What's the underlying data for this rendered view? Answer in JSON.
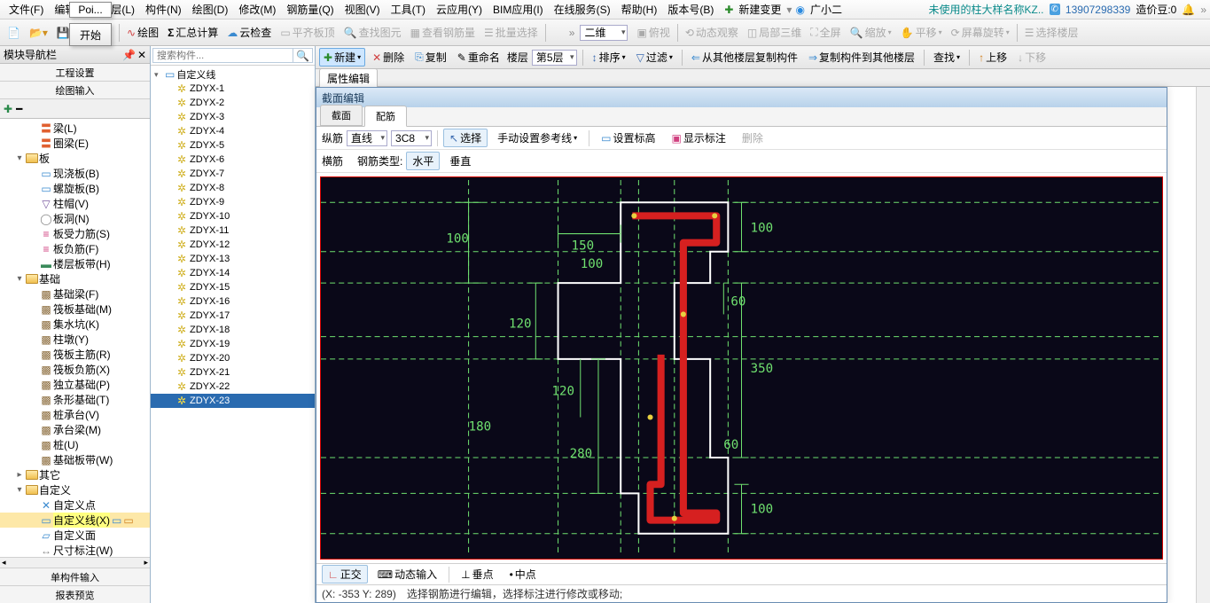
{
  "menu": {
    "items": [
      "文件(F)",
      "编辑(E)",
      "楼层(L)",
      "构件(N)",
      "绘图(D)",
      "修改(M)",
      "钢筋量(Q)",
      "视图(V)",
      "工具(T)",
      "云应用(Y)",
      "BIM应用(I)",
      "在线服务(S)",
      "帮助(H)",
      "版本号(B)"
    ],
    "new_change": "新建变更",
    "user": "广小二",
    "warn": "未使用的柱大样名称KZ..",
    "phone": "13907298339",
    "coin": "造价豆:0"
  },
  "popup": {
    "poi": "Poi...",
    "start": "开始"
  },
  "tb1": {
    "draw": "绘图",
    "sum": "汇总计算",
    "cloud": "云检查",
    "flat": "平齐板顶",
    "find": "查找图元",
    "steel": "查看钢筋量",
    "batch": "批量选择",
    "v2d": "二维",
    "bird": "俯视",
    "dyn": "动态观察",
    "loc3d": "局部三维",
    "full": "全屏",
    "zoom": "缩放",
    "pan": "平移",
    "rot": "屏幕旋转",
    "floor": "选择楼层"
  },
  "left": {
    "title": "模块导航栏",
    "sub1": "工程设置",
    "sub2": "绘图输入",
    "btm1": "单构件输入",
    "btm2": "报表预览",
    "tree": [
      {
        "d": 2,
        "ic": "beam",
        "txt": "梁(L)"
      },
      {
        "d": 2,
        "ic": "beam",
        "txt": "圈梁(E)"
      },
      {
        "d": 1,
        "ic": "fold",
        "txt": "板",
        "ex": "▾"
      },
      {
        "d": 2,
        "ic": "slab",
        "txt": "现浇板(B)"
      },
      {
        "d": 2,
        "ic": "slab",
        "txt": "螺旋板(B)"
      },
      {
        "d": 2,
        "ic": "cap",
        "txt": "柱帽(V)"
      },
      {
        "d": 2,
        "ic": "hole",
        "txt": "板洞(N)"
      },
      {
        "d": 2,
        "ic": "bar",
        "txt": "板受力筋(S)"
      },
      {
        "d": 2,
        "ic": "bar",
        "txt": "板负筋(F)"
      },
      {
        "d": 2,
        "ic": "strip",
        "txt": "楼层板带(H)"
      },
      {
        "d": 1,
        "ic": "fold",
        "txt": "基础",
        "ex": "▾"
      },
      {
        "d": 2,
        "ic": "fnd",
        "txt": "基础梁(F)"
      },
      {
        "d": 2,
        "ic": "fnd",
        "txt": "筏板基础(M)"
      },
      {
        "d": 2,
        "ic": "fnd",
        "txt": "集水坑(K)"
      },
      {
        "d": 2,
        "ic": "fnd",
        "txt": "柱墩(Y)"
      },
      {
        "d": 2,
        "ic": "fnd",
        "txt": "筏板主筋(R)"
      },
      {
        "d": 2,
        "ic": "fnd",
        "txt": "筏板负筋(X)"
      },
      {
        "d": 2,
        "ic": "fnd",
        "txt": "独立基础(P)"
      },
      {
        "d": 2,
        "ic": "fnd",
        "txt": "条形基础(T)"
      },
      {
        "d": 2,
        "ic": "fnd",
        "txt": "桩承台(V)"
      },
      {
        "d": 2,
        "ic": "fnd",
        "txt": "承台梁(M)"
      },
      {
        "d": 2,
        "ic": "fnd",
        "txt": "桩(U)"
      },
      {
        "d": 2,
        "ic": "fnd",
        "txt": "基础板带(W)"
      },
      {
        "d": 1,
        "ic": "fold",
        "txt": "其它",
        "ex": "▸"
      },
      {
        "d": 1,
        "ic": "fold",
        "txt": "自定义",
        "ex": "▾"
      },
      {
        "d": 2,
        "ic": "pt",
        "txt": "自定义点"
      },
      {
        "d": 2,
        "ic": "ln",
        "txt": "自定义线(X)",
        "sel": true,
        "extra": true
      },
      {
        "d": 2,
        "ic": "fc",
        "txt": "自定义面"
      },
      {
        "d": 2,
        "ic": "dm",
        "txt": "尺寸标注(W)"
      }
    ]
  },
  "mid": {
    "new": "新建",
    "del": "删除",
    "copy": "复制",
    "ren": "重命名",
    "floor_lbl": "楼层",
    "floor_val": "第5层",
    "sort": "排序",
    "filter": "过滤",
    "copyfrom": "从其他楼层复制构件",
    "copyto": "复制构件到其他楼层",
    "find": "查找",
    "up": "上移",
    "down": "下移",
    "search_ph": "搜索构件...",
    "root": "自定义线",
    "items": [
      "ZDYX-1",
      "ZDYX-2",
      "ZDYX-3",
      "ZDYX-4",
      "ZDYX-5",
      "ZDYX-6",
      "ZDYX-7",
      "ZDYX-8",
      "ZDYX-9",
      "ZDYX-10",
      "ZDYX-11",
      "ZDYX-12",
      "ZDYX-13",
      "ZDYX-14",
      "ZDYX-15",
      "ZDYX-16",
      "ZDYX-17",
      "ZDYX-18",
      "ZDYX-19",
      "ZDYX-20",
      "ZDYX-21",
      "ZDYX-22",
      "ZDYX-23"
    ],
    "sel": 22
  },
  "prop": {
    "tab": "属性编辑"
  },
  "ed": {
    "title": "截面编辑",
    "tab1": "截面",
    "tab2": "配筋",
    "lon": "纵筋",
    "line": "直线",
    "val": "3C8",
    "sel": "选择",
    "man": "手动设置参考线",
    "elev": "设置标高",
    "show": "显示标注",
    "del": "删除",
    "horiz": "横筋",
    "type_lbl": "钢筋类型:",
    "hz": "水平",
    "vt": "垂直",
    "ortho": "正交",
    "dyn": "动态输入",
    "vert": "垂点",
    "mid": "中点",
    "coord": "(X: -353 Y: 289)",
    "hint": "选择钢筋进行编辑，选择标注进行修改或移动;"
  },
  "dims": {
    "d100a": "100",
    "d150": "150",
    "d100b": "100",
    "d100c": "100",
    "d60a": "60",
    "d120a": "120",
    "d350": "350",
    "d120b": "120",
    "d60b": "60",
    "d180": "180",
    "d280": "280",
    "d100d": "100"
  }
}
